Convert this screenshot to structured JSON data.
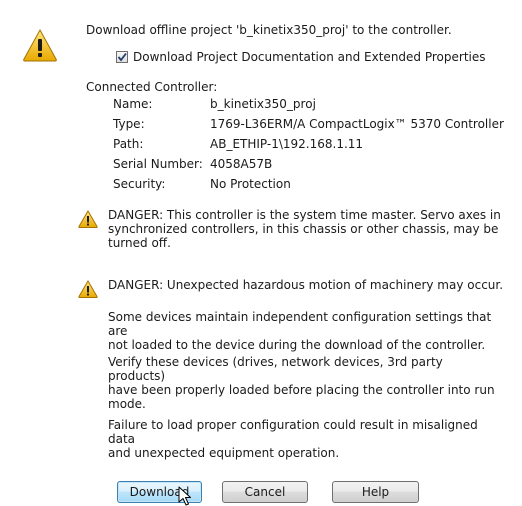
{
  "header": {
    "message": "Download offline project 'b_kinetix350_proj' to the controller.",
    "checkbox_label": "Download Project Documentation and Extended Properties",
    "checkbox_checked": true
  },
  "controller": {
    "section_title": "Connected Controller:",
    "fields": [
      {
        "label": "Name:",
        "value": "b_kinetix350_proj"
      },
      {
        "label": "Type:",
        "value": "1769-L36ERM/A CompactLogix™ 5370 Controller"
      },
      {
        "label": "Path:",
        "value": "AB_ETHIP-1\\192.168.1.11"
      },
      {
        "label": "Serial Number:",
        "value": "4058A57B"
      },
      {
        "label": "Security:",
        "value": "No Protection"
      }
    ]
  },
  "warnings": {
    "danger1_lines": [
      "DANGER: This controller is the system time master.  Servo axes in",
      "synchronized controllers, in this chassis or other chassis, may be",
      "turned off."
    ],
    "danger2": "DANGER: Unexpected hazardous motion of machinery may occur.",
    "para1_lines": [
      "Some devices maintain independent configuration settings that are",
      "not loaded to the device during the download of the controller."
    ],
    "para2_lines": [
      "Verify these devices (drives, network devices, 3rd party products)",
      "have been properly loaded before placing the controller into run",
      "mode."
    ],
    "para3_lines": [
      "Failure to load proper configuration could result in misaligned data",
      "and unexpected equipment operation."
    ]
  },
  "buttons": {
    "download": "Download",
    "cancel": "Cancel",
    "help": "Help"
  },
  "icons": {
    "main": "warning-triangle-icon",
    "danger": "warning-triangle-icon",
    "cursor": "mouse-pointer-icon"
  },
  "colors": {
    "warning_yellow": "#f5c518",
    "default_button_border": "#3c7fb1"
  }
}
